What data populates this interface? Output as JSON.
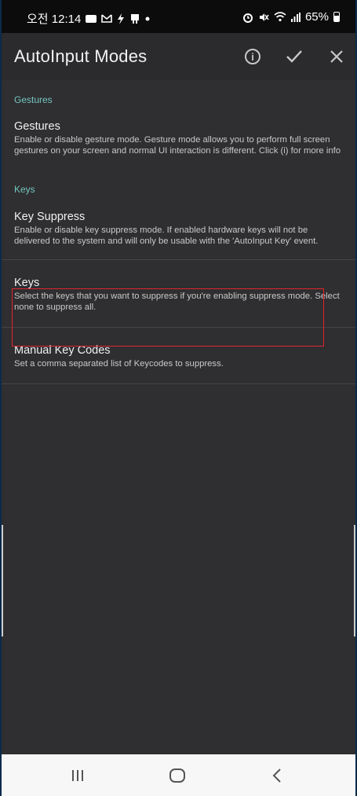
{
  "status_bar": {
    "time": "오전 12:14",
    "battery": "65%",
    "left_icons": [
      "gallery-icon",
      "gmail-icon",
      "flash-icon",
      "screencast-icon",
      "dot-icon"
    ],
    "right_icons": [
      "alarm-icon",
      "mute-icon",
      "wifi-icon",
      "signal-icon",
      "battery-icon"
    ]
  },
  "app_bar": {
    "title": "AutoInput Modes",
    "actions": [
      "info-icon",
      "check-icon",
      "close-icon"
    ]
  },
  "sections": [
    {
      "header": "Gestures",
      "items": [
        {
          "title": "Gestures",
          "summary": "Enable or disable gesture mode. Gesture mode allows you to perform full screen gestures on your screen and normal UI interaction is different. Click (i) for more info"
        }
      ]
    },
    {
      "header": "Keys",
      "items": [
        {
          "title": "Key Suppress",
          "summary": "Enable or disable key suppress mode. If enabled hardware keys will not be delivered to the system and will only be usable with the 'AutoInput Key' event."
        },
        {
          "title": "Keys",
          "summary": "Select the keys that you want to suppress if you're enabling suppress mode. Select none to suppress all."
        },
        {
          "title": "Manual Key Codes",
          "summary": "Set a comma separated list of Keycodes to suppress."
        }
      ]
    }
  ],
  "nav_bar": {
    "buttons": [
      "recents-icon",
      "home-icon",
      "back-icon"
    ]
  },
  "colors": {
    "background": "#2f2e30",
    "app_bar": "#2b2a2c",
    "section_header": "#73c6c0",
    "highlight": "#e0262f"
  }
}
